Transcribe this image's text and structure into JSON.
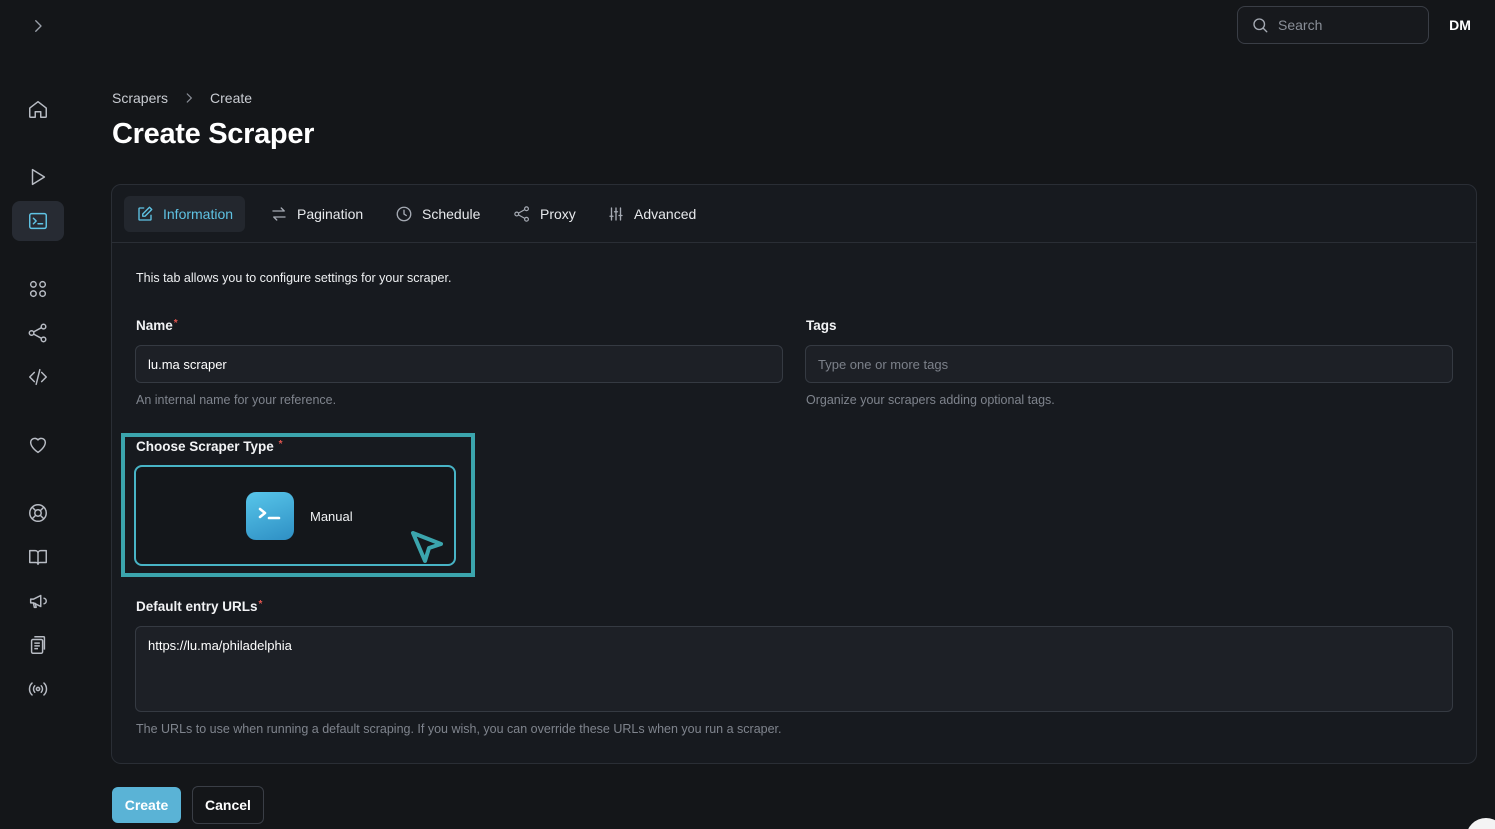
{
  "topbar": {
    "search_placeholder": "Search",
    "user_initials": "DM"
  },
  "sidebar": {
    "items": [
      {
        "icon": "home-icon"
      },
      {
        "icon": "play-icon"
      },
      {
        "icon": "terminal-icon",
        "active": true
      },
      {
        "icon": "grid-icon"
      },
      {
        "icon": "share-icon"
      },
      {
        "icon": "code-icon"
      },
      {
        "icon": "heart-icon"
      },
      {
        "icon": "lifebuoy-icon"
      },
      {
        "icon": "book-icon"
      },
      {
        "icon": "megaphone-icon"
      },
      {
        "icon": "clipboard-icon"
      },
      {
        "icon": "broadcast-icon"
      }
    ]
  },
  "breadcrumb": {
    "items": [
      "Scrapers",
      "Create"
    ]
  },
  "page": {
    "title": "Create Scraper"
  },
  "tabs": [
    {
      "label": "Information",
      "icon": "edit-icon",
      "active": true
    },
    {
      "label": "Pagination",
      "icon": "arrows-icon"
    },
    {
      "label": "Schedule",
      "icon": "clock-icon"
    },
    {
      "label": "Proxy",
      "icon": "share-icon"
    },
    {
      "label": "Advanced",
      "icon": "sliders-icon"
    }
  ],
  "form": {
    "intro": "This tab allows you to configure settings for your scraper.",
    "name": {
      "label": "Name",
      "required_mark": "*",
      "value": "lu.ma scraper",
      "help": "An internal name for your reference."
    },
    "tags": {
      "label": "Tags",
      "placeholder": "Type one or more tags",
      "help": "Organize your scrapers adding optional tags."
    },
    "scraper_type": {
      "label": "Choose Scraper Type",
      "required_mark": "*",
      "option_label": "Manual"
    },
    "urls": {
      "label": "Default entry URLs",
      "required_mark": "*",
      "value": "https://lu.ma/philadelphia",
      "help": "The URLs to use when running a default scraping. If you wish, you can override these URLs when you run a scraper."
    }
  },
  "actions": {
    "create_label": "Create",
    "cancel_label": "Cancel"
  },
  "colors": {
    "accent": "#5fc3e4",
    "highlight": "#3ba5ad",
    "background": "#141619"
  }
}
